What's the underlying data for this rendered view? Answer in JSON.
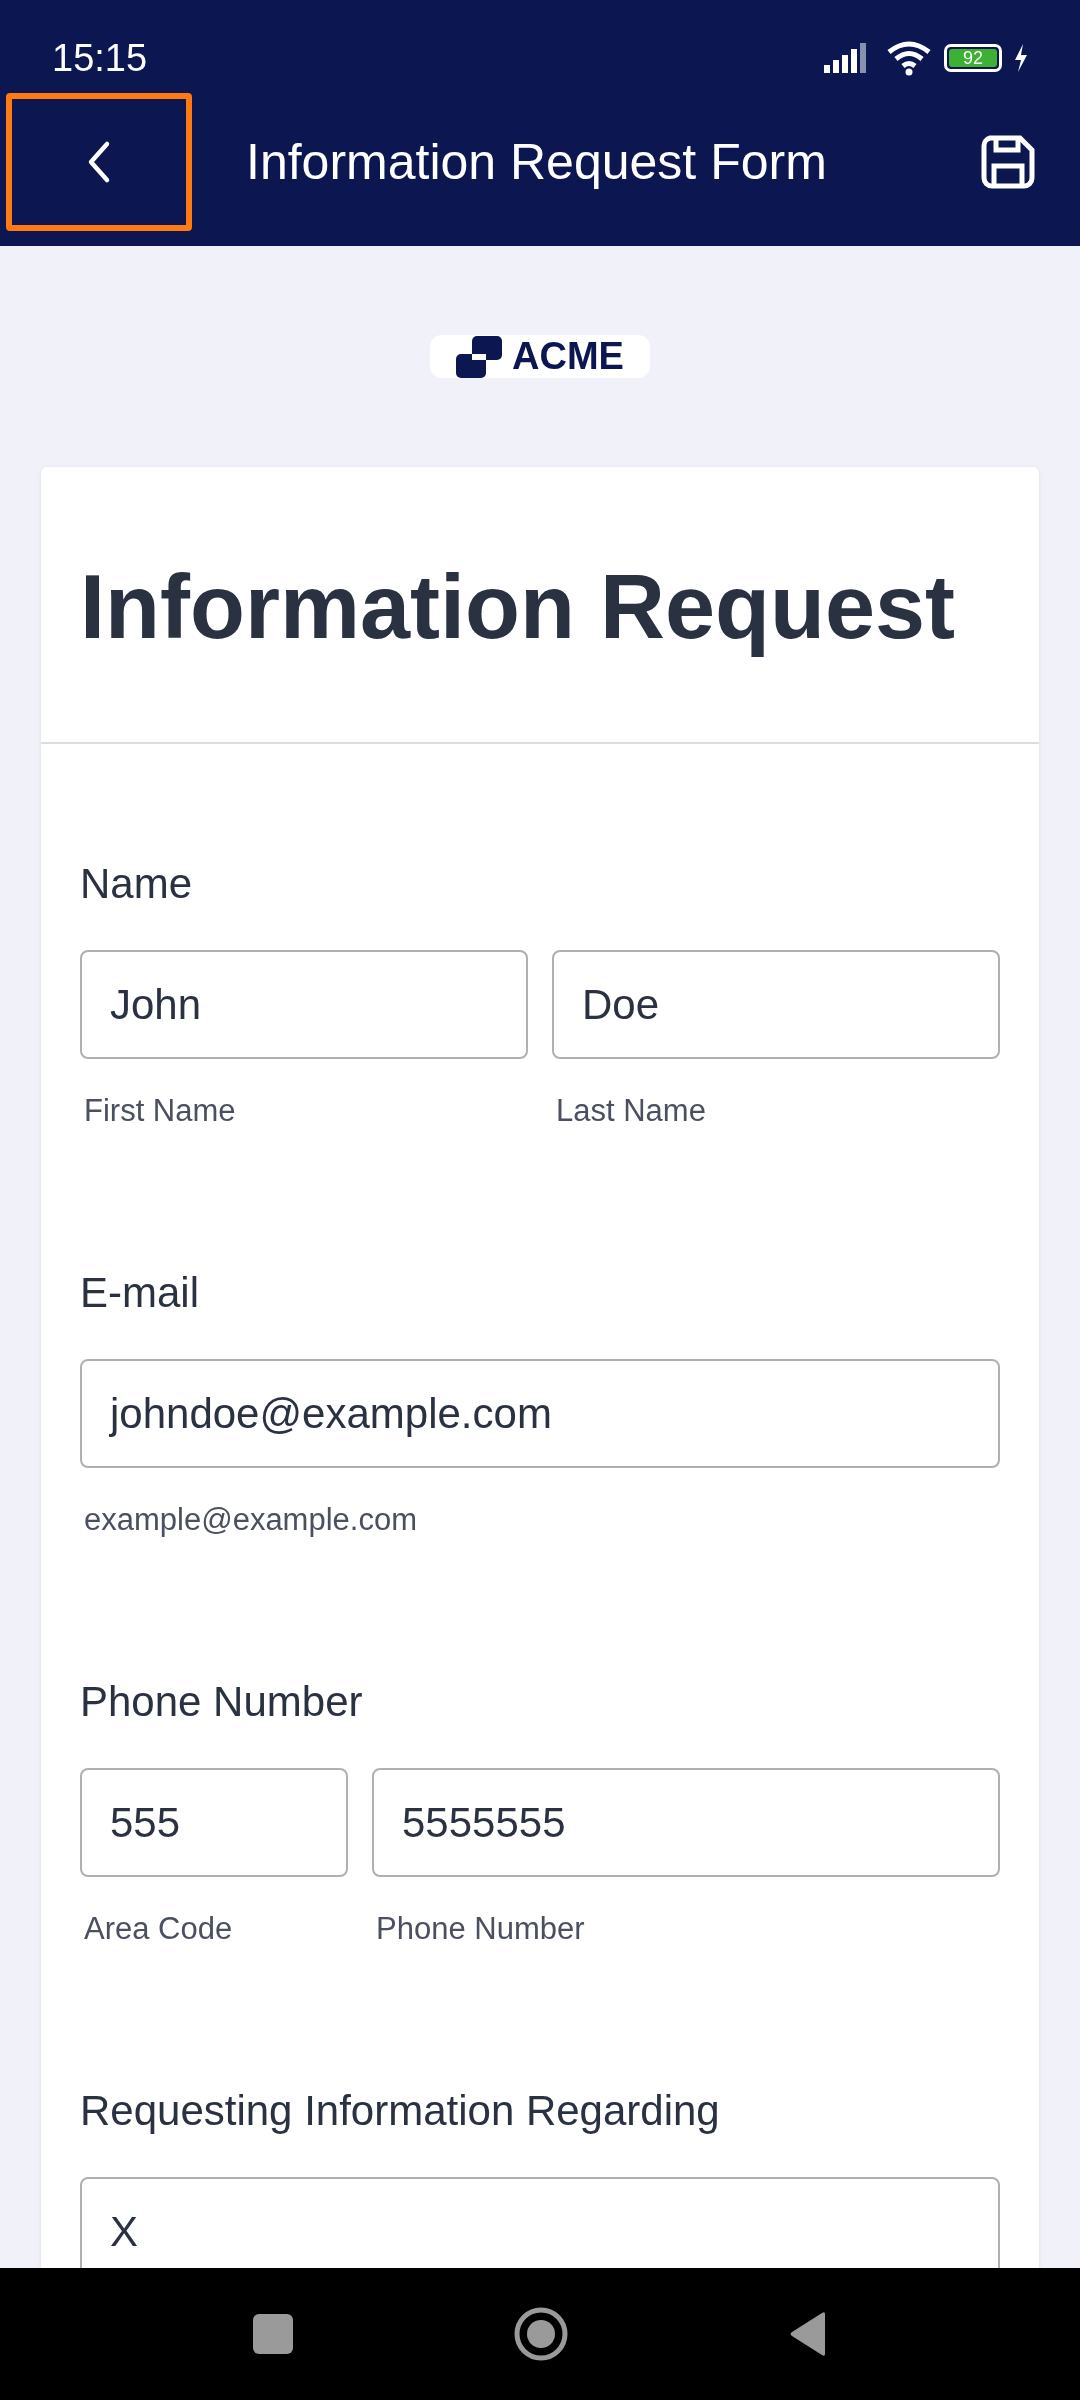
{
  "status_bar": {
    "time": "15:15",
    "battery": "92"
  },
  "header": {
    "back_highlighted": true,
    "title": "Information Request Form"
  },
  "logo": {
    "text": "ACME"
  },
  "form": {
    "title": "Information Request",
    "sections": [
      {
        "label": "Name",
        "fields": [
          {
            "kind": "half",
            "value": "John",
            "sublabel": "First Name"
          },
          {
            "kind": "half",
            "value": "Doe",
            "sublabel": "Last Name"
          }
        ]
      },
      {
        "label": "E-mail",
        "fields": [
          {
            "kind": "full",
            "value": "johndoe@example.com",
            "sublabel": "example@example.com"
          }
        ]
      },
      {
        "label": "Phone Number",
        "fields": [
          {
            "kind": "narrow",
            "value": "555",
            "sublabel": "Area Code"
          },
          {
            "kind": "wide",
            "value": "5555555",
            "sublabel": "Phone Number"
          }
        ]
      },
      {
        "label": "Requesting Information Regarding",
        "fields": [
          {
            "kind": "full",
            "value": "X"
          }
        ]
      }
    ]
  }
}
